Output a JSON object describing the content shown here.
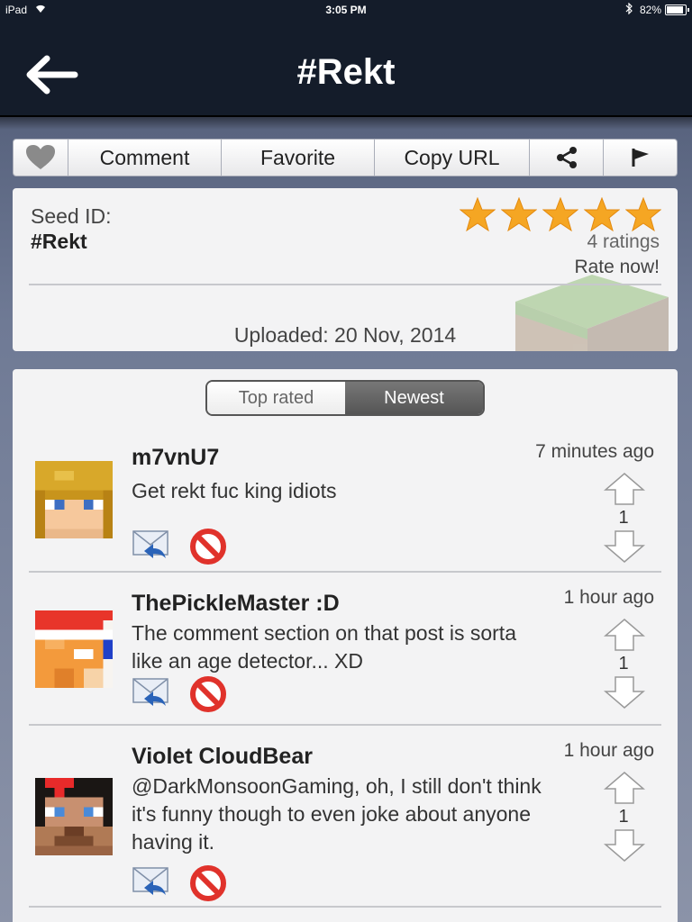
{
  "status": {
    "carrier": "iPad",
    "time": "3:05 PM",
    "battery": "82%"
  },
  "nav": {
    "title": "#Rekt"
  },
  "actions": {
    "comment": "Comment",
    "favorite": "Favorite",
    "copy_url": "Copy URL"
  },
  "seed": {
    "label": "Seed ID:",
    "value": "#Rekt",
    "rating_stars": 5,
    "ratings": "4 ratings",
    "rate_now": "Rate now!",
    "uploaded": "Uploaded: 20 Nov, 2014"
  },
  "tabs": {
    "top_rated": "Top rated",
    "newest": "Newest",
    "selected": "Newest"
  },
  "comments": [
    {
      "author": "m7vnU7",
      "text": "Get rekt fuc king idiots",
      "time": "7 minutes ago",
      "votes": "1"
    },
    {
      "author": "ThePickleMaster :D",
      "text": "The comment section on that post is sorta like an age detector... XD",
      "time": "1 hour ago",
      "votes": "1"
    },
    {
      "author": "Violet CloudBear",
      "text": "@DarkMonsoonGaming, oh, I still don't think it's funny though to even joke about anyone having it.",
      "time": "1 hour ago",
      "votes": "1"
    }
  ],
  "colors": {
    "nav_bg": "#141c2a",
    "star": "#f5a623",
    "block": "#e0322b",
    "selected_tab": "#5e5e5e"
  }
}
